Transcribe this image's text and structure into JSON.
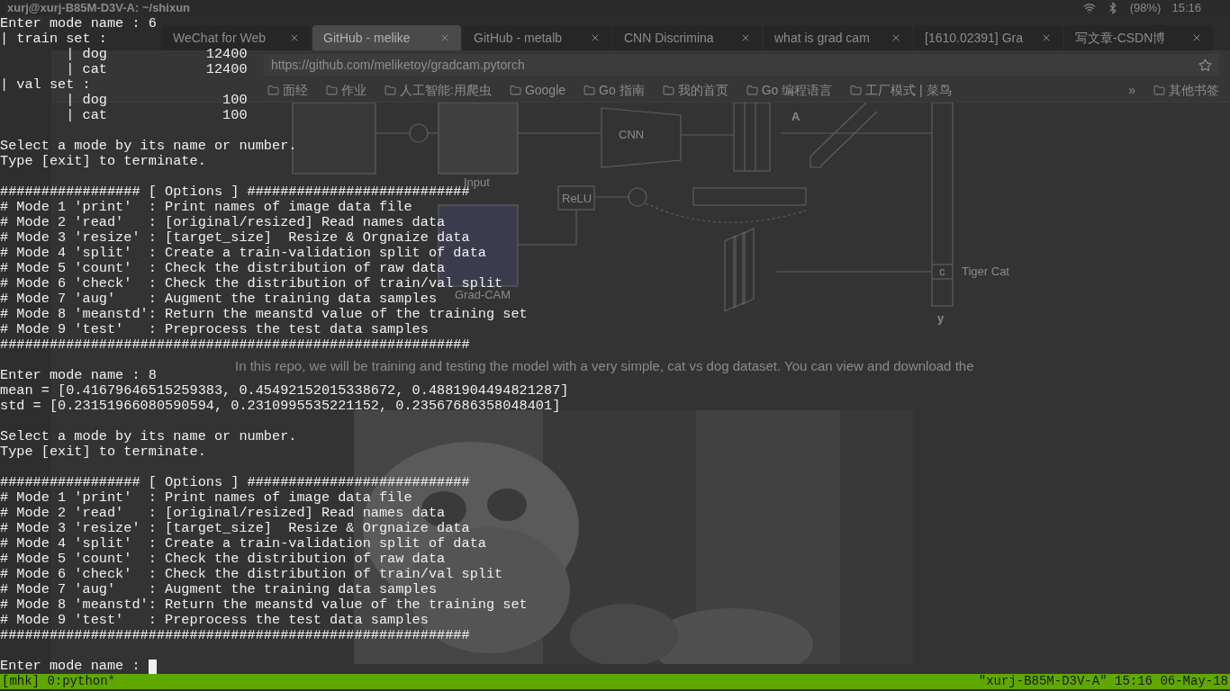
{
  "top_bar": {
    "title": "xurj@xurj-B85M-D3V-A: ~/shixun",
    "battery": "(98%)",
    "time": "15:16"
  },
  "browser": {
    "tabs": [
      {
        "label": "WeChat for Web",
        "selected": false
      },
      {
        "label": "GitHub - melike",
        "selected": true
      },
      {
        "label": "GitHub - metalb",
        "selected": false
      },
      {
        "label": "CNN Discrimina",
        "selected": false
      },
      {
        "label": "what is grad cam",
        "selected": false
      },
      {
        "label": "[1610.02391] Gra",
        "selected": false
      },
      {
        "label": "写文章-CSDN博",
        "selected": false
      }
    ],
    "url": "https://github.com/meliketoy/gradcam.pytorch",
    "bookmarks": [
      "面经",
      "作业",
      "人工智能:用爬虫",
      "Google",
      "Go 指南",
      "我的首页",
      "Go 编程语言",
      "工厂模式 | 菜鸟"
    ],
    "more": "»",
    "other_bookmarks": "其他书签",
    "figure": {
      "input": "Input",
      "cnn": "CNN",
      "a": "A",
      "relu": "ReLU",
      "gradcam": "Grad-CAM",
      "class": "Tiger Cat",
      "c": "c",
      "y": "y"
    },
    "paragraph": "In this repo, we will be training and testing the model with a very simple, cat vs dog dataset. You can view and download the"
  },
  "terminal": {
    "blocks": [
      [
        "Enter mode name : 6",
        "| train set :",
        "        | dog            12400",
        "        | cat            12400",
        "| val set :",
        "        | dog              100",
        "        | cat              100"
      ],
      [
        "Select a mode by its name or number.",
        "Type [exit] to terminate."
      ],
      [
        "################# [ Options ] ###########################",
        "# Mode 1 'print'  : Print names of image data file",
        "# Mode 2 'read'   : [original/resized] Read names data",
        "# Mode 3 'resize' : [target_size]  Resize & Orgnaize data",
        "# Mode 4 'split'  : Create a train-validation split of data",
        "# Mode 5 'count'  : Check the distribution of raw data",
        "# Mode 6 'check'  : Check the distribution of train/val split",
        "# Mode 7 'aug'    : Augment the training data samples",
        "# Mode 8 'meanstd': Return the meanstd value of the training set",
        "# Mode 9 'test'   : Preprocess the test data samples",
        "#########################################################"
      ],
      [
        "Enter mode name : 8",
        "mean = [0.41679646515259383, 0.45492152015338672, 0.4881904494821287]",
        "std = [0.23151966080590594, 0.2310995535221152, 0.23567686358048401]"
      ],
      [
        "Select a mode by its name or number.",
        "Type [exit] to terminate."
      ],
      [
        "################# [ Options ] ###########################",
        "# Mode 1 'print'  : Print names of image data file",
        "# Mode 2 'read'   : [original/resized] Read names data",
        "# Mode 3 'resize' : [target_size]  Resize & Orgnaize data",
        "# Mode 4 'split'  : Create a train-validation split of data",
        "# Mode 5 'count'  : Check the distribution of raw data",
        "# Mode 6 'check'  : Check the distribution of train/val split",
        "# Mode 7 'aug'    : Augment the training data samples",
        "# Mode 8 'meanstd': Return the meanstd value of the training set",
        "# Mode 9 'test'   : Preprocess the test data samples",
        "#########################################################"
      ]
    ],
    "prompt": "Enter mode name :"
  },
  "status_bar": {
    "left": "[mhk] 0:python*",
    "right": "\"xurj-B85M-D3V-A\" 15:16 06-May-18"
  }
}
